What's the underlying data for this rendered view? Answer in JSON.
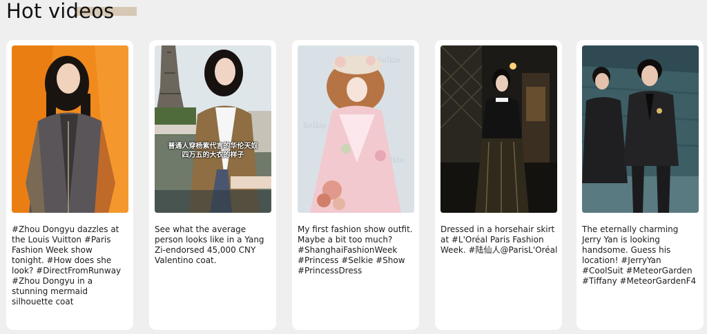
{
  "page": {
    "title": "Hot videos"
  },
  "videos": [
    {
      "caption": "#Zhou Dongyu dazzles at\nthe Louis Vuitton #Paris\nFashion Week show\ntonight. #How does she\nlook? #DirectFromRunway\n#Zhou Dongyu in a\nstunning mermaid\nsilhouette coat",
      "thumb_theme": "orange-backdrop"
    },
    {
      "caption": "See what the average\nperson looks like in a Yang\nZi-endorsed 45,000 CNY\nValentino coat.",
      "overlay_text": "普通人穿杨紫代言的华伦天奴\n四万五的大衣的样子",
      "thumb_theme": "paris-tower"
    },
    {
      "caption": "My first fashion show outfit.\nMaybe a bit too much?\n#ShanghaiFashionWeek\n#Princess #Selkie #Show\n#PrincessDress",
      "watermark": "Selkie",
      "thumb_theme": "floral-dress"
    },
    {
      "caption": "Dressed in a horsehair skirt\nat #L'Oréal Paris Fashion\nWeek. #陆仙人@ParisL'Oréal",
      "thumb_theme": "dark-interior"
    },
    {
      "caption": "The eternally charming\nJerry Yan is looking\nhandsome. Guess his\nlocation! #JerryYan\n#CoolSuit #MeteorGarden\n#Tiffany #MeteorGardenF4",
      "thumb_theme": "teal-wall"
    }
  ]
}
